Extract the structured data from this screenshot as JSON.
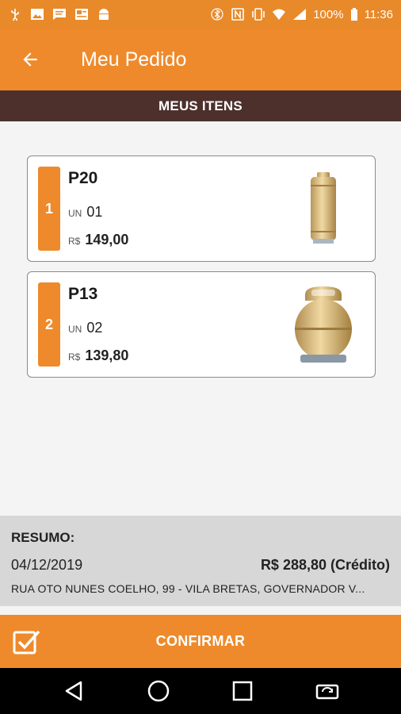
{
  "status_bar": {
    "battery": "100%",
    "time": "11:36",
    "left_icons": [
      "usb-icon",
      "image-icon",
      "message-icon",
      "news-icon",
      "android-icon"
    ],
    "right_icons": [
      "bluetooth-icon",
      "nfc-icon",
      "vibrate-icon",
      "wifi-icon",
      "signal-icon",
      "battery-icon"
    ]
  },
  "app_bar": {
    "back_icon": "arrow-left-icon",
    "title": "Meu Pedido"
  },
  "section": {
    "title": "MEUS ITENS"
  },
  "items": [
    {
      "index": "1",
      "name": "P20",
      "qty_label": "UN",
      "qty": "01",
      "price_label": "R$",
      "price": "149,00",
      "image": "gas-cylinder-tall"
    },
    {
      "index": "2",
      "name": "P13",
      "qty_label": "UN",
      "qty": "02",
      "price_label": "R$",
      "price": "139,80",
      "image": "gas-cylinder-round"
    }
  ],
  "summary": {
    "title": "RESUMO:",
    "date": "04/12/2019",
    "total": "R$ 288,80 (Crédito)",
    "address": "RUA OTO NUNES COELHO, 99 - VILA BRETAS, GOVERNADOR V..."
  },
  "confirm": {
    "icon": "checkbox-check-icon",
    "label": "CONFIRMAR"
  },
  "nav_bar": {
    "icons": [
      "back-triangle-icon",
      "home-circle-icon",
      "recents-square-icon",
      "rotate-icon"
    ]
  },
  "colors": {
    "accent": "#ee8a2b",
    "section_bar": "#4d302c",
    "summary_bg": "#d7d7d7"
  }
}
